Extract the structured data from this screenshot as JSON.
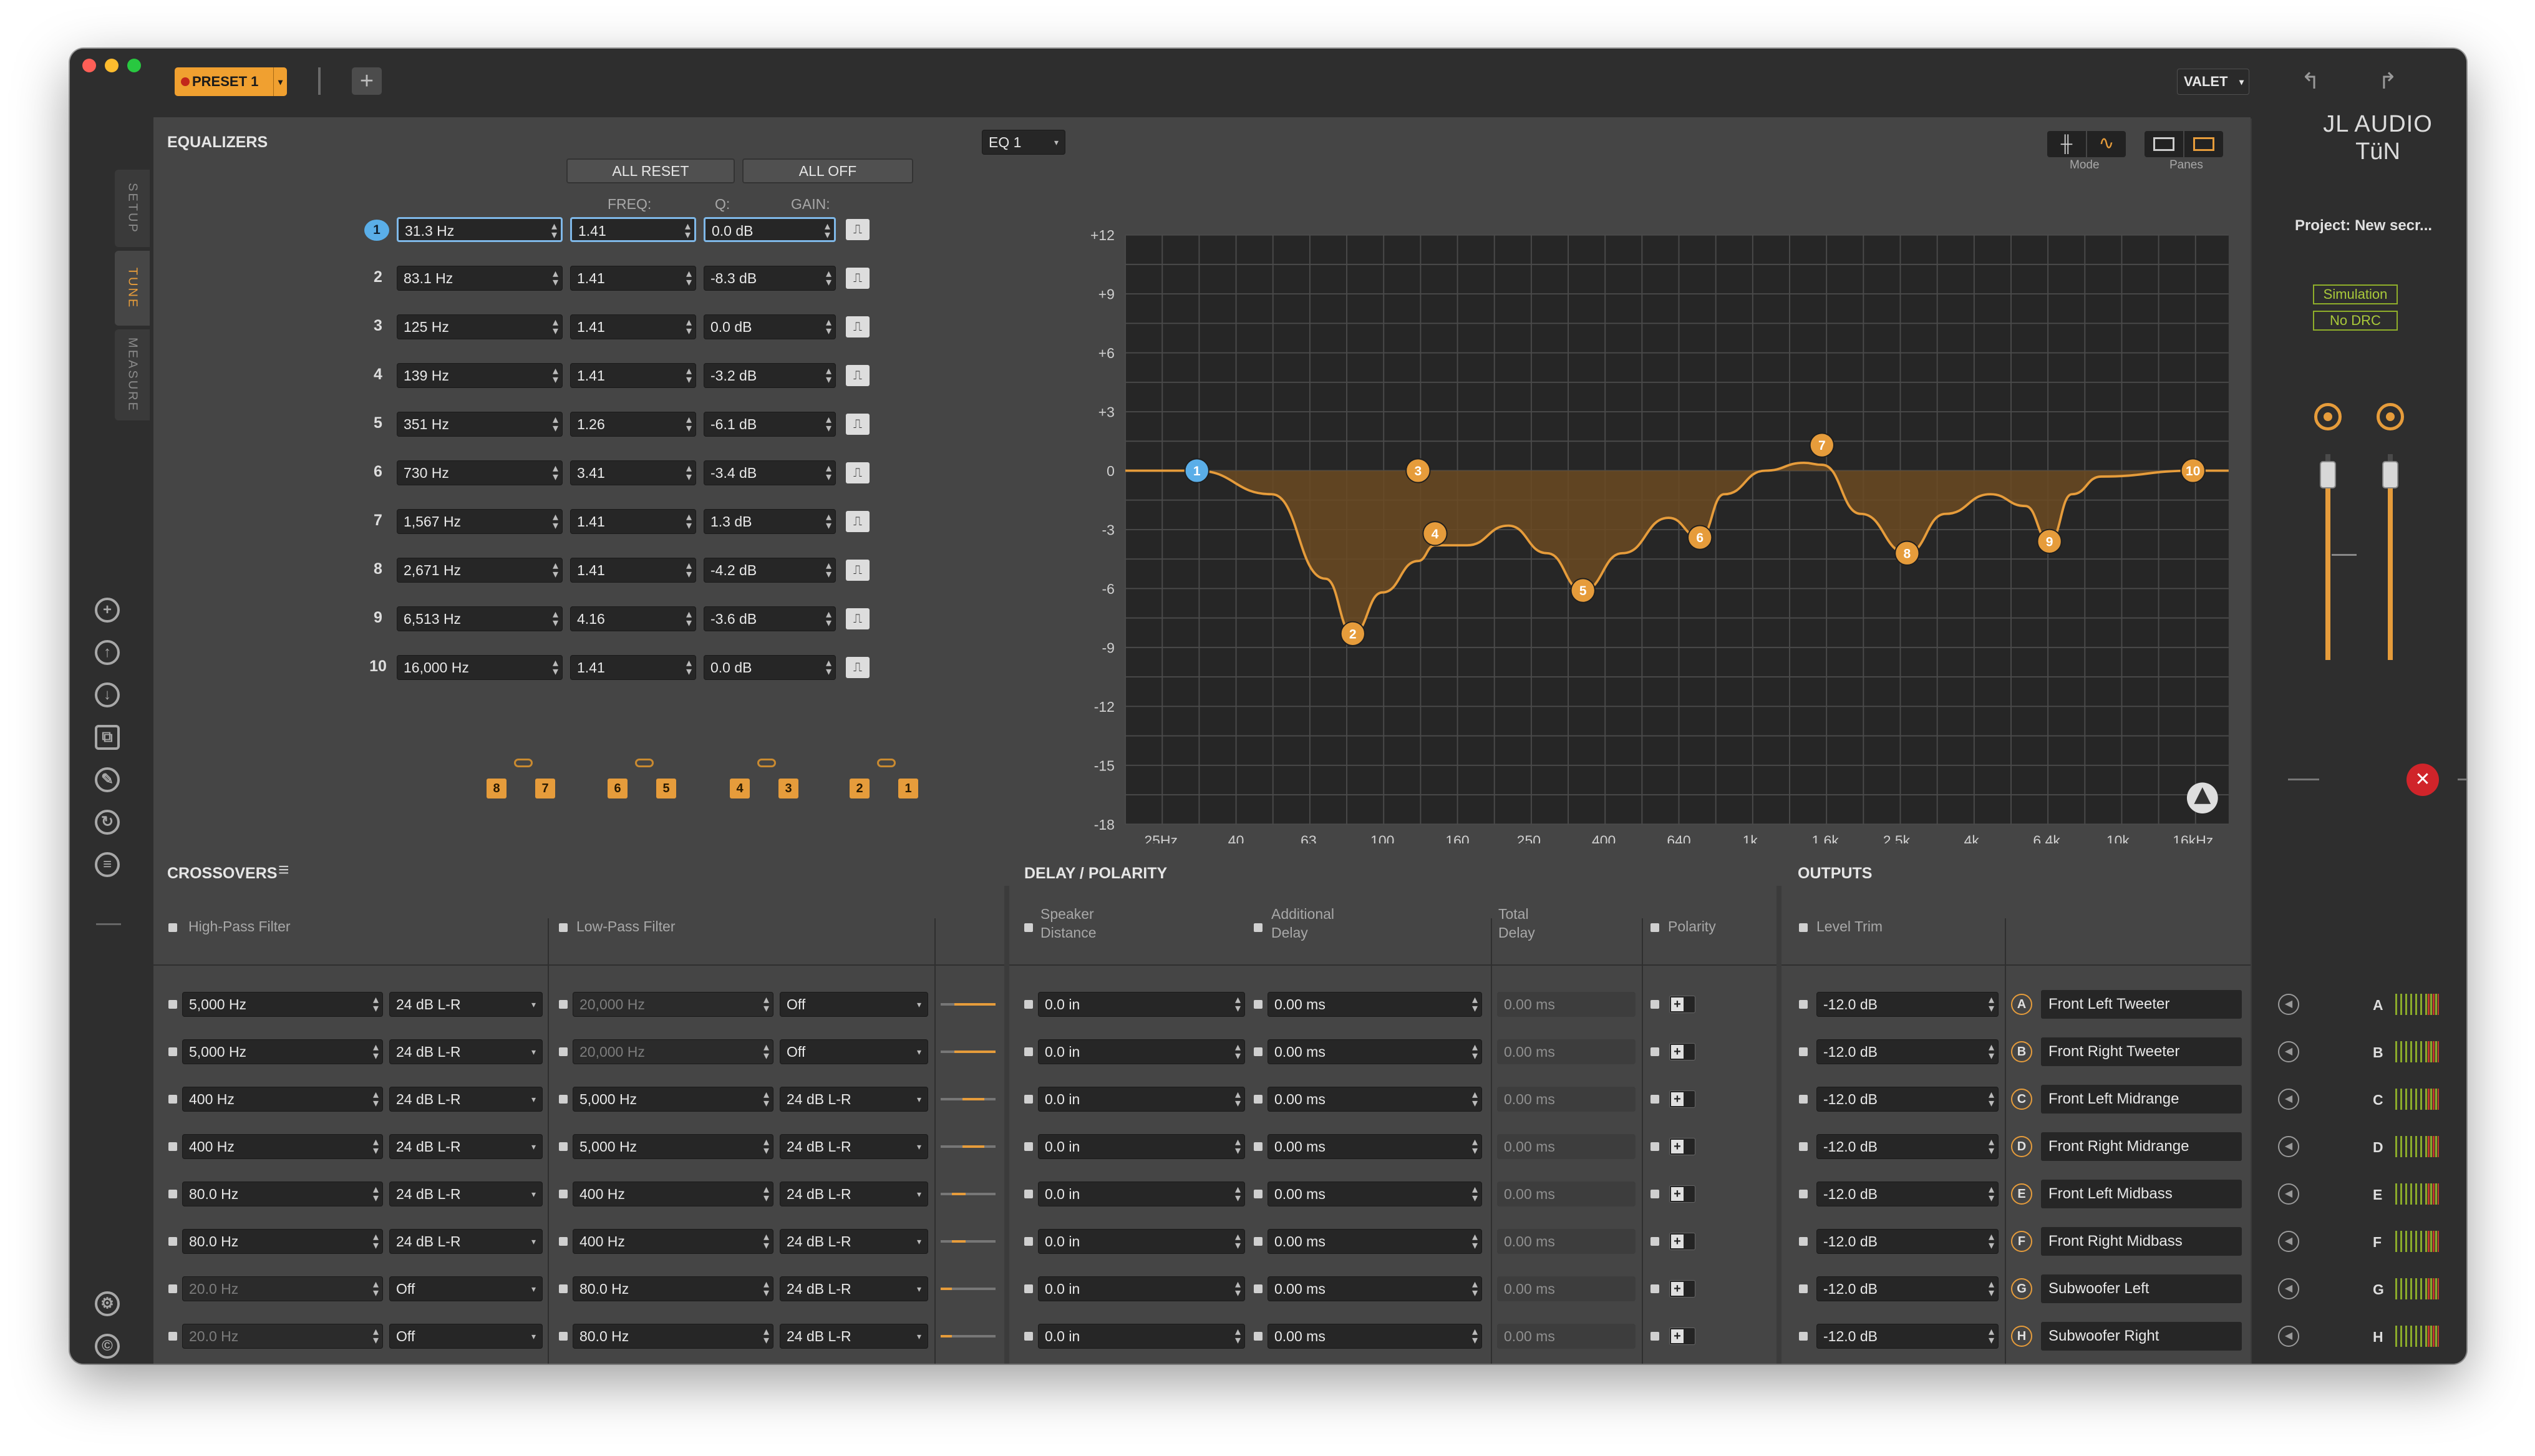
{
  "titlebar": {
    "preset_label": "PRESET 1",
    "user_label": "VALET",
    "add_icon": "plus-icon",
    "undo_icon": "undo-arrow-icon",
    "redo_icon": "redo-arrow-icon"
  },
  "sidebar": {
    "tabs": [
      {
        "label": "SETUP",
        "active": false
      },
      {
        "label": "TUNE",
        "active": true
      },
      {
        "label": "MEASURE",
        "active": false
      }
    ],
    "icons": [
      "plus-circle-icon",
      "upload-icon",
      "download-icon",
      "copy-icon",
      "tools-icon",
      "refresh-icon",
      "list-icon"
    ],
    "bottom_icons": [
      "gear-icon",
      "copyright-icon",
      "help-icon"
    ]
  },
  "equalizers": {
    "title": "EQUALIZERS",
    "all_reset": "ALL RESET",
    "all_off": "ALL OFF",
    "col_freq": "FREQ:",
    "col_q": "Q:",
    "col_gain": "GAIN:",
    "select_label": "EQ 1",
    "mode_label": "Mode",
    "panes_label": "Panes",
    "bands": [
      {
        "num": "1",
        "freq": "31.3 Hz",
        "q": "1.41",
        "gain": "0.0 dB"
      },
      {
        "num": "2",
        "freq": "83.1 Hz",
        "q": "1.41",
        "gain": "-8.3 dB"
      },
      {
        "num": "3",
        "freq": "125 Hz",
        "q": "1.41",
        "gain": "0.0 dB"
      },
      {
        "num": "4",
        "freq": "139 Hz",
        "q": "1.41",
        "gain": "-3.2 dB"
      },
      {
        "num": "5",
        "freq": "351 Hz",
        "q": "1.26",
        "gain": "-6.1 dB"
      },
      {
        "num": "6",
        "freq": "730 Hz",
        "q": "3.41",
        "gain": "-3.4 dB"
      },
      {
        "num": "7",
        "freq": "1,567 Hz",
        "q": "1.41",
        "gain": "1.3 dB"
      },
      {
        "num": "8",
        "freq": "2,671 Hz",
        "q": "1.41",
        "gain": "-4.2 dB"
      },
      {
        "num": "9",
        "freq": "6,513 Hz",
        "q": "4.16",
        "gain": "-3.6 dB"
      },
      {
        "num": "10",
        "freq": "16,000 Hz",
        "q": "1.41",
        "gain": "0.0 dB"
      }
    ],
    "linked_pairs": [
      [
        "8",
        "7"
      ],
      [
        "6",
        "5"
      ],
      [
        "4",
        "3"
      ],
      [
        "2",
        "1"
      ]
    ]
  },
  "chart_data": {
    "type": "line",
    "title": "",
    "xlabel": "",
    "ylabel": "",
    "ylim": [
      -18,
      12
    ],
    "x_scale": "log",
    "xlim": [
      20,
      20000
    ],
    "grid": true,
    "y_ticks": [
      "+12",
      "+9",
      "+6",
      "+3",
      "0",
      "-3",
      "-6",
      "-9",
      "-12",
      "-15",
      "-18"
    ],
    "x_ticks": [
      {
        "label": "25Hz",
        "f": 25
      },
      {
        "label": "40",
        "f": 40
      },
      {
        "label": "63",
        "f": 63
      },
      {
        "label": "100",
        "f": 100
      },
      {
        "label": "160",
        "f": 160
      },
      {
        "label": "250",
        "f": 250
      },
      {
        "label": "400",
        "f": 400
      },
      {
        "label": "640",
        "f": 640
      },
      {
        "label": "1k",
        "f": 1000
      },
      {
        "label": "1.6k",
        "f": 1600
      },
      {
        "label": "2.5k",
        "f": 2500
      },
      {
        "label": "4k",
        "f": 4000
      },
      {
        "label": "6.4k",
        "f": 6400
      },
      {
        "label": "10k",
        "f": 10000
      },
      {
        "label": "16kHz",
        "f": 16000
      }
    ],
    "curve": [
      {
        "f": 20,
        "g": 0
      },
      {
        "f": 31.3,
        "g": 0
      },
      {
        "f": 50,
        "g": -1.2
      },
      {
        "f": 70,
        "g": -5.5
      },
      {
        "f": 83.1,
        "g": -8.3
      },
      {
        "f": 100,
        "g": -6.2
      },
      {
        "f": 125,
        "g": -4.6
      },
      {
        "f": 139,
        "g": -3.8
      },
      {
        "f": 170,
        "g": -3.8
      },
      {
        "f": 220,
        "g": -2.8
      },
      {
        "f": 280,
        "g": -4.2
      },
      {
        "f": 351,
        "g": -6.1
      },
      {
        "f": 450,
        "g": -4.2
      },
      {
        "f": 600,
        "g": -2.4
      },
      {
        "f": 730,
        "g": -3.4
      },
      {
        "f": 850,
        "g": -1.2
      },
      {
        "f": 1100,
        "g": 0
      },
      {
        "f": 1400,
        "g": 0.4
      },
      {
        "f": 1567,
        "g": 0.3
      },
      {
        "f": 2000,
        "g": -2.2
      },
      {
        "f": 2671,
        "g": -4.2
      },
      {
        "f": 3400,
        "g": -2.2
      },
      {
        "f": 4500,
        "g": -1.2
      },
      {
        "f": 5600,
        "g": -1.8
      },
      {
        "f": 6513,
        "g": -3.6
      },
      {
        "f": 7500,
        "g": -1.2
      },
      {
        "f": 9000,
        "g": -0.3
      },
      {
        "f": 16000,
        "g": 0
      },
      {
        "f": 20000,
        "g": 0
      }
    ],
    "markers": [
      {
        "label": "1",
        "f": 31.3,
        "g": 0,
        "color": "#5aaee8"
      },
      {
        "label": "2",
        "f": 83.1,
        "g": -8.3,
        "color": "#e69c3b"
      },
      {
        "label": "3",
        "f": 125,
        "g": 0,
        "color": "#e69c3b"
      },
      {
        "label": "4",
        "f": 139,
        "g": -3.2,
        "color": "#e69c3b"
      },
      {
        "label": "5",
        "f": 351,
        "g": -6.1,
        "color": "#e69c3b"
      },
      {
        "label": "6",
        "f": 730,
        "g": -3.4,
        "color": "#e69c3b"
      },
      {
        "label": "7",
        "f": 1567,
        "g": 1.3,
        "color": "#e69c3b"
      },
      {
        "label": "8",
        "f": 2671,
        "g": -4.2,
        "color": "#e69c3b"
      },
      {
        "label": "9",
        "f": 6513,
        "g": -3.6,
        "color": "#e69c3b"
      },
      {
        "label": "10",
        "f": 16000,
        "g": 0,
        "color": "#e69c3b"
      }
    ],
    "line_color": "#e69c3b",
    "fill_color": "#6b4a22"
  },
  "crossovers": {
    "title": "CROSSOVERS",
    "hp_label": "High-Pass Filter",
    "lp_label": "Low-Pass Filter",
    "rows": [
      {
        "hp_freq": "5,000 Hz",
        "hp_slope": "24 dB L-R",
        "hp_dim": false,
        "lp_freq": "20,000 Hz",
        "lp_slope": "Off",
        "lp_dim": true,
        "band": [
          0.25,
          1.0
        ]
      },
      {
        "hp_freq": "5,000 Hz",
        "hp_slope": "24 dB L-R",
        "hp_dim": false,
        "lp_freq": "20,000 Hz",
        "lp_slope": "Off",
        "lp_dim": true,
        "band": [
          0.25,
          1.0
        ]
      },
      {
        "hp_freq": "400 Hz",
        "hp_slope": "24 dB L-R",
        "hp_dim": false,
        "lp_freq": "5,000 Hz",
        "lp_slope": "24 dB L-R",
        "lp_dim": false,
        "band": [
          0.4,
          0.8
        ]
      },
      {
        "hp_freq": "400 Hz",
        "hp_slope": "24 dB L-R",
        "hp_dim": false,
        "lp_freq": "5,000 Hz",
        "lp_slope": "24 dB L-R",
        "lp_dim": false,
        "band": [
          0.4,
          0.8
        ]
      },
      {
        "hp_freq": "80.0 Hz",
        "hp_slope": "24 dB L-R",
        "hp_dim": false,
        "lp_freq": "400 Hz",
        "lp_slope": "24 dB L-R",
        "lp_dim": false,
        "band": [
          0.2,
          0.45
        ]
      },
      {
        "hp_freq": "80.0 Hz",
        "hp_slope": "24 dB L-R",
        "hp_dim": false,
        "lp_freq": "400 Hz",
        "lp_slope": "24 dB L-R",
        "lp_dim": false,
        "band": [
          0.2,
          0.45
        ]
      },
      {
        "hp_freq": "20.0 Hz",
        "hp_slope": "Off",
        "hp_dim": true,
        "lp_freq": "80.0 Hz",
        "lp_slope": "24 dB L-R",
        "lp_dim": false,
        "band": [
          0.0,
          0.2
        ]
      },
      {
        "hp_freq": "20.0 Hz",
        "hp_slope": "Off",
        "hp_dim": true,
        "lp_freq": "80.0 Hz",
        "lp_slope": "24 dB L-R",
        "lp_dim": false,
        "band": [
          0.0,
          0.2
        ]
      }
    ]
  },
  "delay": {
    "title": "DELAY / POLARITY",
    "col_distance": [
      "Speaker",
      "Distance"
    ],
    "col_additional": [
      "Additional",
      "Delay"
    ],
    "col_total": [
      "Total",
      "Delay"
    ],
    "col_polarity": "Polarity",
    "rows": [
      {
        "distance": "0.0 in",
        "additional": "0.00 ms",
        "total": "0.00 ms"
      },
      {
        "distance": "0.0 in",
        "additional": "0.00 ms",
        "total": "0.00 ms"
      },
      {
        "distance": "0.0 in",
        "additional": "0.00 ms",
        "total": "0.00 ms"
      },
      {
        "distance": "0.0 in",
        "additional": "0.00 ms",
        "total": "0.00 ms"
      },
      {
        "distance": "0.0 in",
        "additional": "0.00 ms",
        "total": "0.00 ms"
      },
      {
        "distance": "0.0 in",
        "additional": "0.00 ms",
        "total": "0.00 ms"
      },
      {
        "distance": "0.0 in",
        "additional": "0.00 ms",
        "total": "0.00 ms"
      },
      {
        "distance": "0.0 in",
        "additional": "0.00 ms",
        "total": "0.00 ms"
      }
    ]
  },
  "outputs": {
    "title": "OUTPUTS",
    "col_level": "Level Trim",
    "rows": [
      {
        "level": "-12.0 dB",
        "letter": "A",
        "name": "Front Left Tweeter"
      },
      {
        "level": "-12.0 dB",
        "letter": "B",
        "name": "Front Right Tweeter"
      },
      {
        "level": "-12.0 dB",
        "letter": "C",
        "name": "Front Left Midrange"
      },
      {
        "level": "-12.0 dB",
        "letter": "D",
        "name": "Front Right Midrange"
      },
      {
        "level": "-12.0 dB",
        "letter": "E",
        "name": "Front Left Midbass"
      },
      {
        "level": "-12.0 dB",
        "letter": "F",
        "name": "Front Right Midbass"
      },
      {
        "level": "-12.0 dB",
        "letter": "G",
        "name": "Subwoofer Left"
      },
      {
        "level": "-12.0 dB",
        "letter": "H",
        "name": "Subwoofer Right"
      }
    ]
  },
  "rightpanel": {
    "logo_line1": "JL AUDIO",
    "logo_line2": "TüN",
    "project": "Project: New secr...",
    "simulation": "Simulation",
    "no_drc": "No DRC",
    "fader_left_level": 0.9,
    "fader_right_level": 0.9
  },
  "colors": {
    "accent": "#e69c3b",
    "band1": "#5aaee8",
    "status_green": "#a9c93a",
    "mute_red": "#d0242a"
  }
}
